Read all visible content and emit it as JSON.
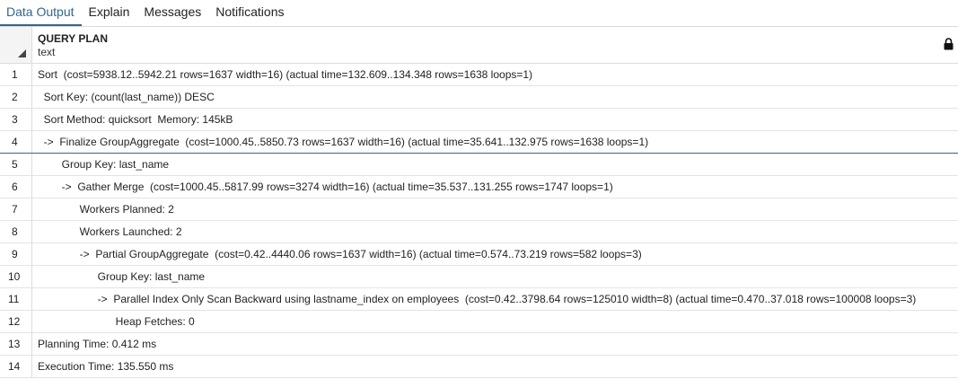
{
  "tabs": [
    "Data Output",
    "Explain",
    "Messages",
    "Notifications"
  ],
  "column": {
    "name": "QUERY PLAN",
    "type": "text"
  },
  "rows": [
    "Sort  (cost=5938.12..5942.21 rows=1637 width=16) (actual time=132.609..134.348 rows=1638 loops=1)",
    "  Sort Key: (count(last_name)) DESC",
    "  Sort Method: quicksort  Memory: 145kB",
    "  ->  Finalize GroupAggregate  (cost=1000.45..5850.73 rows=1637 width=16) (actual time=35.641..132.975 rows=1638 loops=1)",
    "        Group Key: last_name",
    "        ->  Gather Merge  (cost=1000.45..5817.99 rows=3274 width=16) (actual time=35.537..131.255 rows=1747 loops=1)",
    "              Workers Planned: 2",
    "              Workers Launched: 2",
    "              ->  Partial GroupAggregate  (cost=0.42..4440.06 rows=1637 width=16) (actual time=0.574..73.219 rows=582 loops=3)",
    "                    Group Key: last_name",
    "                    ->  Parallel Index Only Scan Backward using lastname_index on employees  (cost=0.42..3798.64 rows=125010 width=8) (actual time=0.470..37.018 rows=100008 loops=3)",
    "                          Heap Fetches: 0",
    "Planning Time: 0.412 ms",
    "Execution Time: 135.550 ms"
  ]
}
